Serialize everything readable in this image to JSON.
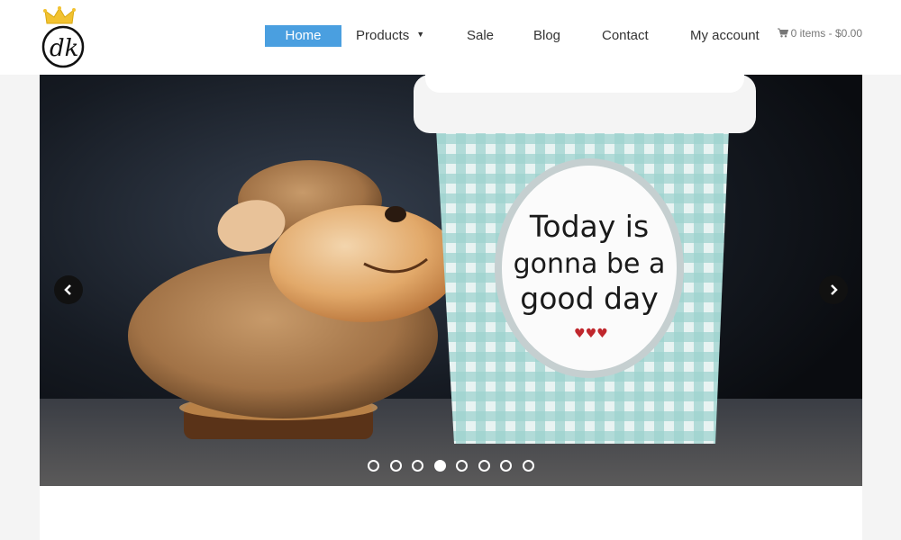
{
  "header": {
    "logo_alt": "dk logo",
    "nav": [
      {
        "label": "Home",
        "active": true
      },
      {
        "label": "Products",
        "has_dropdown": true
      },
      {
        "label": "Sale"
      },
      {
        "label": "Blog"
      },
      {
        "label": "Contact"
      },
      {
        "label": "My account"
      }
    ],
    "cart_text": "0 items - $0.00"
  },
  "slider": {
    "mug_text_lines": [
      "Today is",
      "gonna be a",
      "good day"
    ],
    "slide_count": 8,
    "active_slide": 4
  },
  "colors": {
    "nav_active": "#4a9fe0",
    "crown": "#f2c230"
  }
}
